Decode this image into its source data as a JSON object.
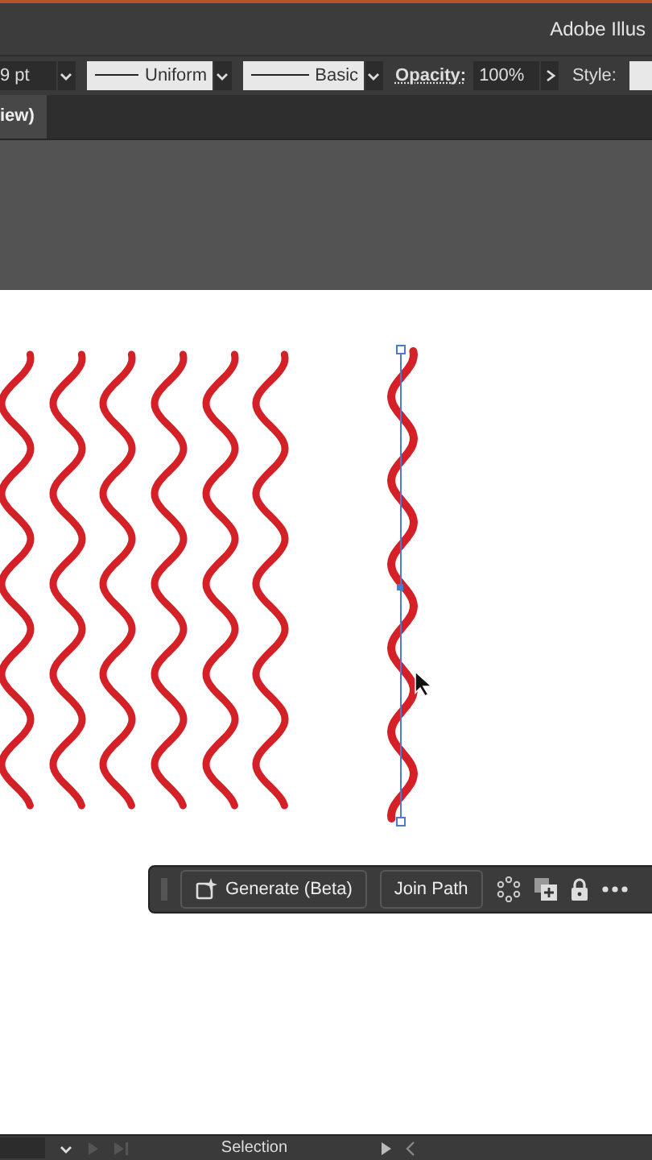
{
  "app_title": "Adobe Illus",
  "control_bar": {
    "stroke_weight": "9 pt",
    "profile": "Uniform",
    "brush": "Basic",
    "opacity_label": "Opacity:",
    "opacity": "100%",
    "style_label": "Style:"
  },
  "tabs": [
    {
      "label": "iew)",
      "selected": true
    }
  ],
  "context_toolbar": {
    "buttons": [
      "Generate (Beta)",
      "Join Path"
    ]
  },
  "status_bar": {
    "tool": "Selection"
  }
}
